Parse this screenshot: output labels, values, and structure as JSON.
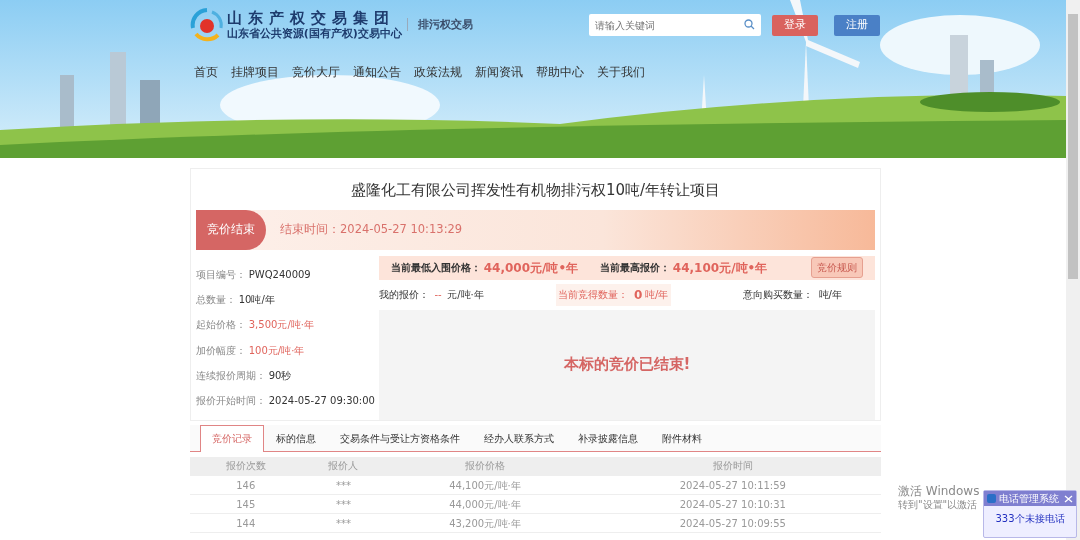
{
  "header": {
    "logo_line_1": "山东产权交易集团",
    "logo_line_2": "山东省公共资源(国有产权)交易中心",
    "section": "排污权交易",
    "search": {
      "placeholder": "请输入关键词"
    },
    "buttons": [
      {
        "label": "登录",
        "kind": "login"
      },
      {
        "label": "注册",
        "kind": "register"
      }
    ]
  },
  "nav": [
    "首页",
    "挂牌项目",
    "竞价大厅",
    "通知公告",
    "政策法规",
    "新闻资讯",
    "帮助中心",
    "关于我们"
  ],
  "project": {
    "title": "盛隆化工有限公司挥发性有机物排污权10吨/年转让项目",
    "status": "竞价结束",
    "end_time": "结束时间：2024-05-27 10:13:29"
  },
  "info": [
    {
      "label": "项目编号：",
      "value": "PWQ240009",
      "highlight": false
    },
    {
      "label": "总数量：",
      "value": "10吨/年",
      "highlight": false
    },
    {
      "label": "起始价格：",
      "value": "3,500元/吨·年",
      "highlight": true
    },
    {
      "label": "加价幅度：",
      "value": "100元/吨·年",
      "highlight": true
    },
    {
      "label": "连续报价周期：",
      "value": "90秒",
      "highlight": false
    },
    {
      "label": "报价开始时间：",
      "value": "2024-05-27 09:30:00",
      "highlight": false
    }
  ],
  "prices": [
    {
      "label": "当前最低入围价格：",
      "value": "44,000元/吨•年"
    },
    {
      "label": "当前最高报价：",
      "value": "44,100元/吨•年"
    }
  ],
  "rules_button": "竞价规则",
  "bid": {
    "my_label": "我的报价：",
    "my_value": "--",
    "my_unit": "元/吨·年",
    "won_label": "当前竞得数量：",
    "won_value": "0",
    "won_unit": "吨/年",
    "intent_label": "意向购买数量：",
    "intent_unit": "吨/年"
  },
  "message": "本标的竞价已结束!",
  "tabs": [
    {
      "label": "竞价记录",
      "selected": true
    },
    {
      "label": "标的信息",
      "selected": false
    },
    {
      "label": "交易条件与受让方资格条件",
      "selected": false
    },
    {
      "label": "经办人联系方式",
      "selected": false
    },
    {
      "label": "补录披露信息",
      "selected": false
    },
    {
      "label": "附件材料",
      "selected": false
    }
  ],
  "table": {
    "columns": [
      "报价次数",
      "报价人",
      "报价价格",
      "报价时间"
    ],
    "rows": [
      [
        "146",
        "***",
        "44,100元/吨·年",
        "2024-05-27 10:11:59"
      ],
      [
        "145",
        "***",
        "44,000元/吨·年",
        "2024-05-27 10:10:31"
      ],
      [
        "144",
        "***",
        "43,200元/吨·年",
        "2024-05-27 10:09:55"
      ]
    ]
  },
  "os_overlay": {
    "line_1": "激活 Windows",
    "line_2": "转到\"设置\"以激活"
  },
  "popup": {
    "title": "电话管理系统",
    "message": "333个未接电话"
  }
}
